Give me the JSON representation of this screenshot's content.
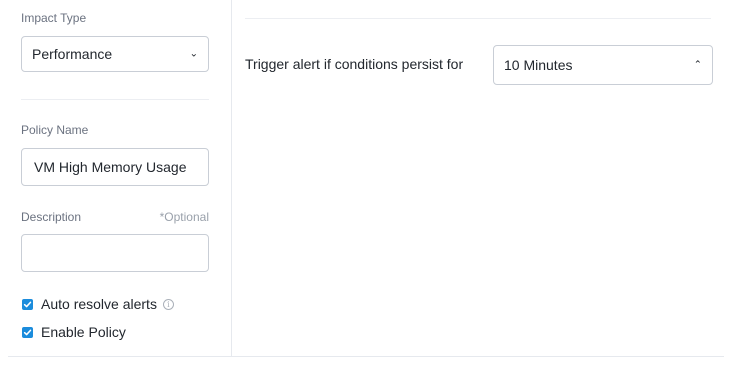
{
  "impact_type": {
    "label": "Impact Type",
    "selected": "Performance",
    "chevron_icon": "chevron-down-icon"
  },
  "policy_name": {
    "label": "Policy Name",
    "value": "VM High Memory Usage"
  },
  "description": {
    "label": "Description",
    "optional_tag": "*Optional",
    "value": ""
  },
  "options": {
    "auto_resolve": {
      "label": "Auto resolve alerts",
      "checked": true
    },
    "enable_policy": {
      "label": "Enable Policy",
      "checked": true
    }
  },
  "trigger": {
    "text": "Trigger alert if conditions persist for",
    "selected": "10 Minutes",
    "chevron_icon": "chevron-up-icon"
  },
  "colors": {
    "checkbox_accent": "#1b8cdc",
    "border": "#c9ced6",
    "label_text": "#6b7280"
  }
}
